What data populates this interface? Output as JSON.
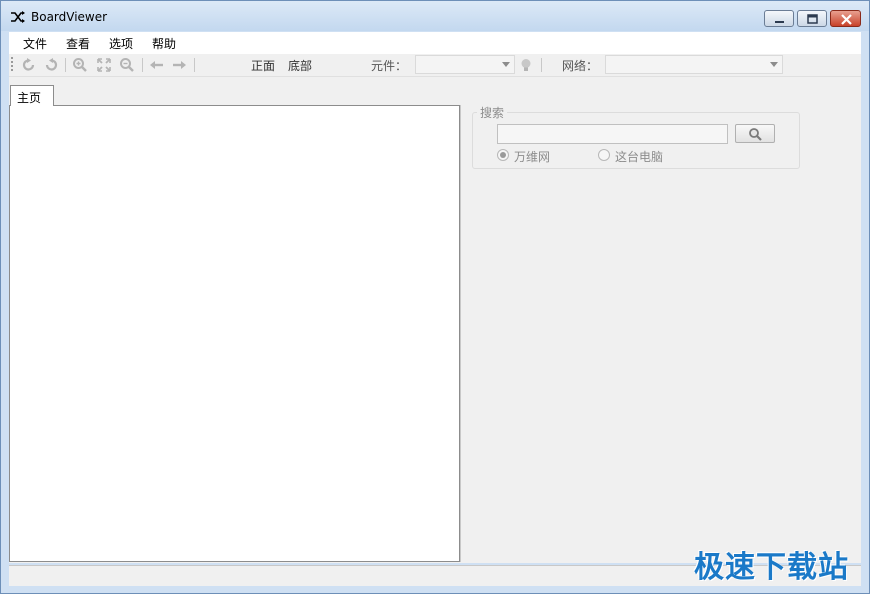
{
  "window": {
    "title": "BoardViewer",
    "icon": "shuffle-icon",
    "controls": [
      "minimize-icon",
      "maximize-icon",
      "close-icon"
    ]
  },
  "menu": {
    "items": [
      "文件",
      "查看",
      "选项",
      "帮助"
    ]
  },
  "toolbar": {
    "icons": [
      "rotate-left-icon",
      "rotate-right-icon",
      "zoom-in-icon",
      "fit-icon",
      "zoom-out-icon",
      "arrow-left-icon",
      "arrow-right-icon"
    ],
    "front_label": "正面",
    "bottom_label": "底部",
    "component_label": "元件：",
    "component_value": "",
    "bulb_icon": "lightbulb-icon",
    "net_label": "网络：",
    "net_value": ""
  },
  "tabs": [
    {
      "label": "主页",
      "active": true
    }
  ],
  "search": {
    "group_title": "搜索",
    "input_value": "",
    "button_icon": "search-icon",
    "options": [
      {
        "label": "万维网",
        "selected": true
      },
      {
        "label": "这台电脑",
        "selected": false
      }
    ]
  },
  "status": {
    "text": ""
  },
  "watermark": {
    "text": "极速下载站"
  },
  "colors": {
    "titlebar": "#c3d8ef",
    "close_button": "#c8422a",
    "watermark": "#1a79c8"
  }
}
